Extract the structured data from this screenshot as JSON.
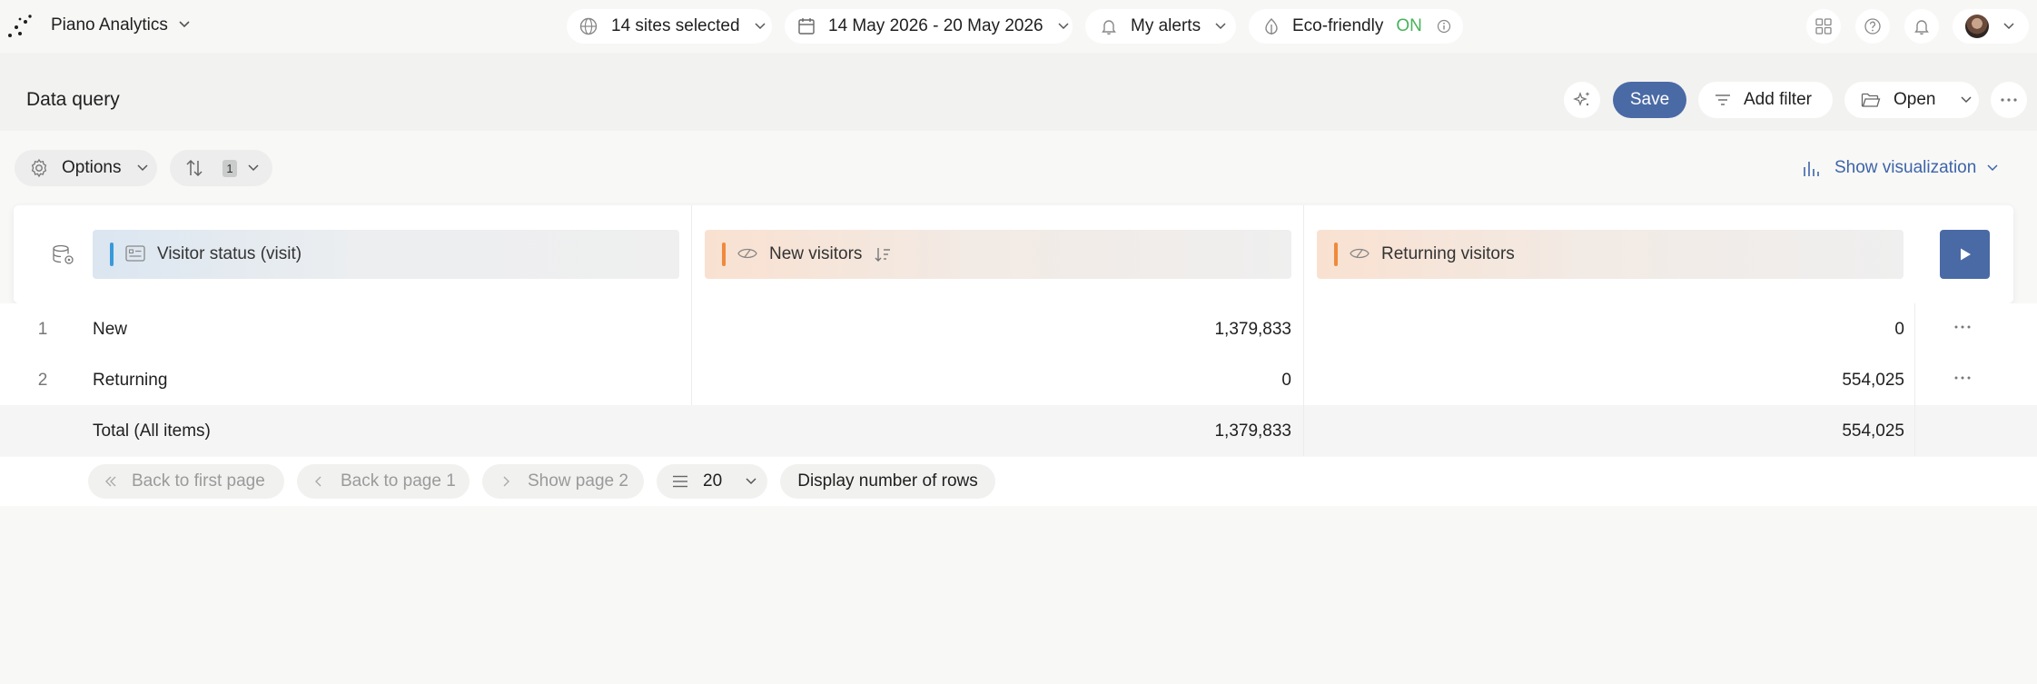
{
  "app": {
    "name": "Piano Analytics"
  },
  "topbar": {
    "sites_label": "14 sites selected",
    "date_range": "14 May 2026 - 20 May 2026",
    "alerts_label": "My alerts",
    "eco_label": "Eco-friendly",
    "eco_state": "ON"
  },
  "header": {
    "title": "Data query",
    "save_label": "Save",
    "add_filter_label": "Add filter",
    "open_label": "Open"
  },
  "toolbar": {
    "options_label": "Options",
    "sort_count": "1",
    "show_visualization_label": "Show visualization"
  },
  "query": {
    "dimension": "Visitor status (visit)",
    "metric_1": "New visitors",
    "metric_2": "Returning visitors"
  },
  "table": {
    "rows": [
      {
        "index": "1",
        "label": "New",
        "new_visitors": "1,379,833",
        "returning_visitors": "0"
      },
      {
        "index": "2",
        "label": "Returning",
        "new_visitors": "0",
        "returning_visitors": "554,025"
      }
    ],
    "total": {
      "label": "Total (All items)",
      "new_visitors": "1,379,833",
      "returning_visitors": "554,025"
    }
  },
  "pagination": {
    "first_page_label": "Back to first page",
    "prev_page_label": "Back to page 1",
    "next_page_label": "Show page 2",
    "rows_per_page": "20",
    "display_rows_label": "Display number of rows"
  },
  "colors": {
    "accent": "#4a6aa5",
    "link": "#3e64a8",
    "dimension_bar": "#3a9ad9",
    "metric_bar": "#ef8a3c",
    "eco_on": "#46b35a"
  },
  "icons": [
    "piano-logo-icon",
    "chevron-down-icon",
    "globe-icon",
    "calendar-icon",
    "bell-icon",
    "leaf-icon",
    "info-icon",
    "apps-grid-icon",
    "help-icon",
    "notification-icon",
    "sparkle-icon",
    "filter-icon",
    "folder-icon",
    "more-icon",
    "gear-icon",
    "sort-icon",
    "bar-chart-icon",
    "database-settings-icon",
    "dimension-icon",
    "metric-icon",
    "sort-desc-icon",
    "play-icon",
    "double-chevron-left-icon",
    "chevron-left-icon",
    "chevron-right-icon",
    "list-icon"
  ]
}
